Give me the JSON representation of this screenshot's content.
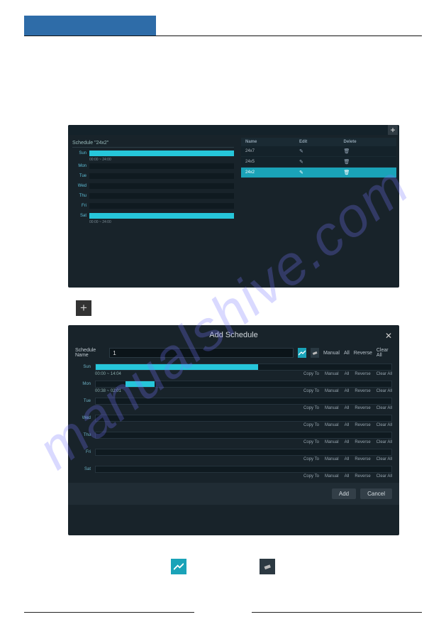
{
  "watermark": "manualshive.com",
  "plus_glyph": "+",
  "fig1": {
    "title": "Schedule \"24x2\"",
    "days": [
      {
        "label": "Sun",
        "fill": 1.0,
        "sub": "00:00 ~ 24:00"
      },
      {
        "label": "Mon",
        "fill": 0.0
      },
      {
        "label": "Tue",
        "fill": 0.0
      },
      {
        "label": "Wed",
        "fill": 0.0
      },
      {
        "label": "Thu",
        "fill": 0.0
      },
      {
        "label": "Fri",
        "fill": 0.0
      },
      {
        "label": "Sat",
        "fill": 1.0,
        "sub": "00:00 ~ 24:00"
      }
    ],
    "table": {
      "headers": {
        "name": "Name",
        "edit": "Edit",
        "delete": "Delete"
      },
      "rows": [
        {
          "name": "24x7",
          "selected": false
        },
        {
          "name": "24x5",
          "selected": false
        },
        {
          "name": "24x2",
          "selected": true
        }
      ]
    }
  },
  "fig2": {
    "title": "Add Schedule",
    "close": "✕",
    "name_label": "Schedule Name",
    "name_value": "1",
    "toolbar": {
      "manual": "Manual",
      "all": "All",
      "reverse": "Reverse",
      "clear_all": "Clear All"
    },
    "row_actions": {
      "copy_to": "Copy To",
      "manual": "Manual",
      "all": "All",
      "reverse": "Reverse",
      "clear_all": "Clear All"
    },
    "days": [
      {
        "label": "Sun",
        "fill": 0.55,
        "sub": "00:00 ~ 14:04"
      },
      {
        "label": "Mon",
        "seg_start": 0.1,
        "seg_end": 0.2,
        "sub": "00:38 ~ 02:01"
      },
      {
        "label": "Tue",
        "fill": 0.0
      },
      {
        "label": "Wed",
        "fill": 0.0
      },
      {
        "label": "Thu",
        "fill": 0.0
      },
      {
        "label": "Fri",
        "fill": 0.0
      },
      {
        "label": "Sat",
        "fill": 0.0
      }
    ],
    "buttons": {
      "add": "Add",
      "cancel": "Cancel"
    }
  }
}
